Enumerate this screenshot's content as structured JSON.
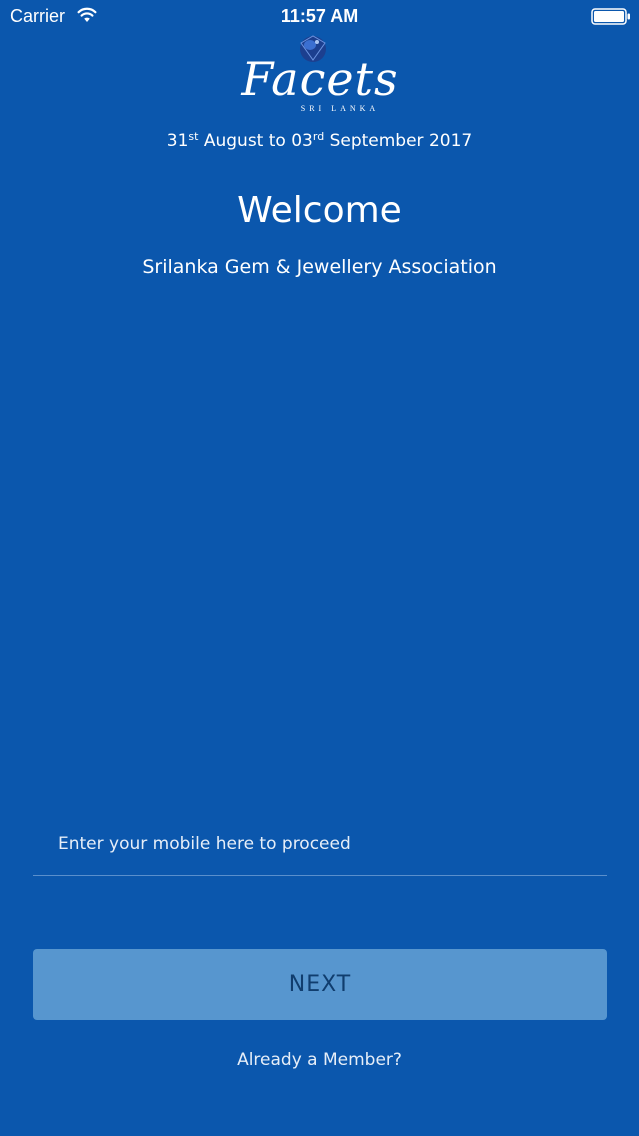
{
  "status_bar": {
    "carrier": "Carrier",
    "time": "11:57 AM"
  },
  "logo": {
    "name": "Facets",
    "subtitle": "SRI LANKA"
  },
  "event_dates": {
    "start_day": "31",
    "start_suffix": "st",
    "start_rest": " August to 03",
    "end_suffix": "rd",
    "end_rest": " September 2017"
  },
  "welcome": {
    "title": "Welcome",
    "organization": "Srilanka Gem & Jewellery Association"
  },
  "form": {
    "mobile_placeholder": "Enter your mobile here to proceed",
    "mobile_value": "",
    "next_label": "NEXT",
    "member_link": "Already a Member?"
  },
  "colors": {
    "background": "#0b57ad",
    "button": "#5796cf",
    "button_text": "#103d6e",
    "divider": "#5a8fcc"
  },
  "icons": {
    "wifi": "wifi-icon",
    "battery": "battery-icon",
    "gem": "gem-icon"
  }
}
